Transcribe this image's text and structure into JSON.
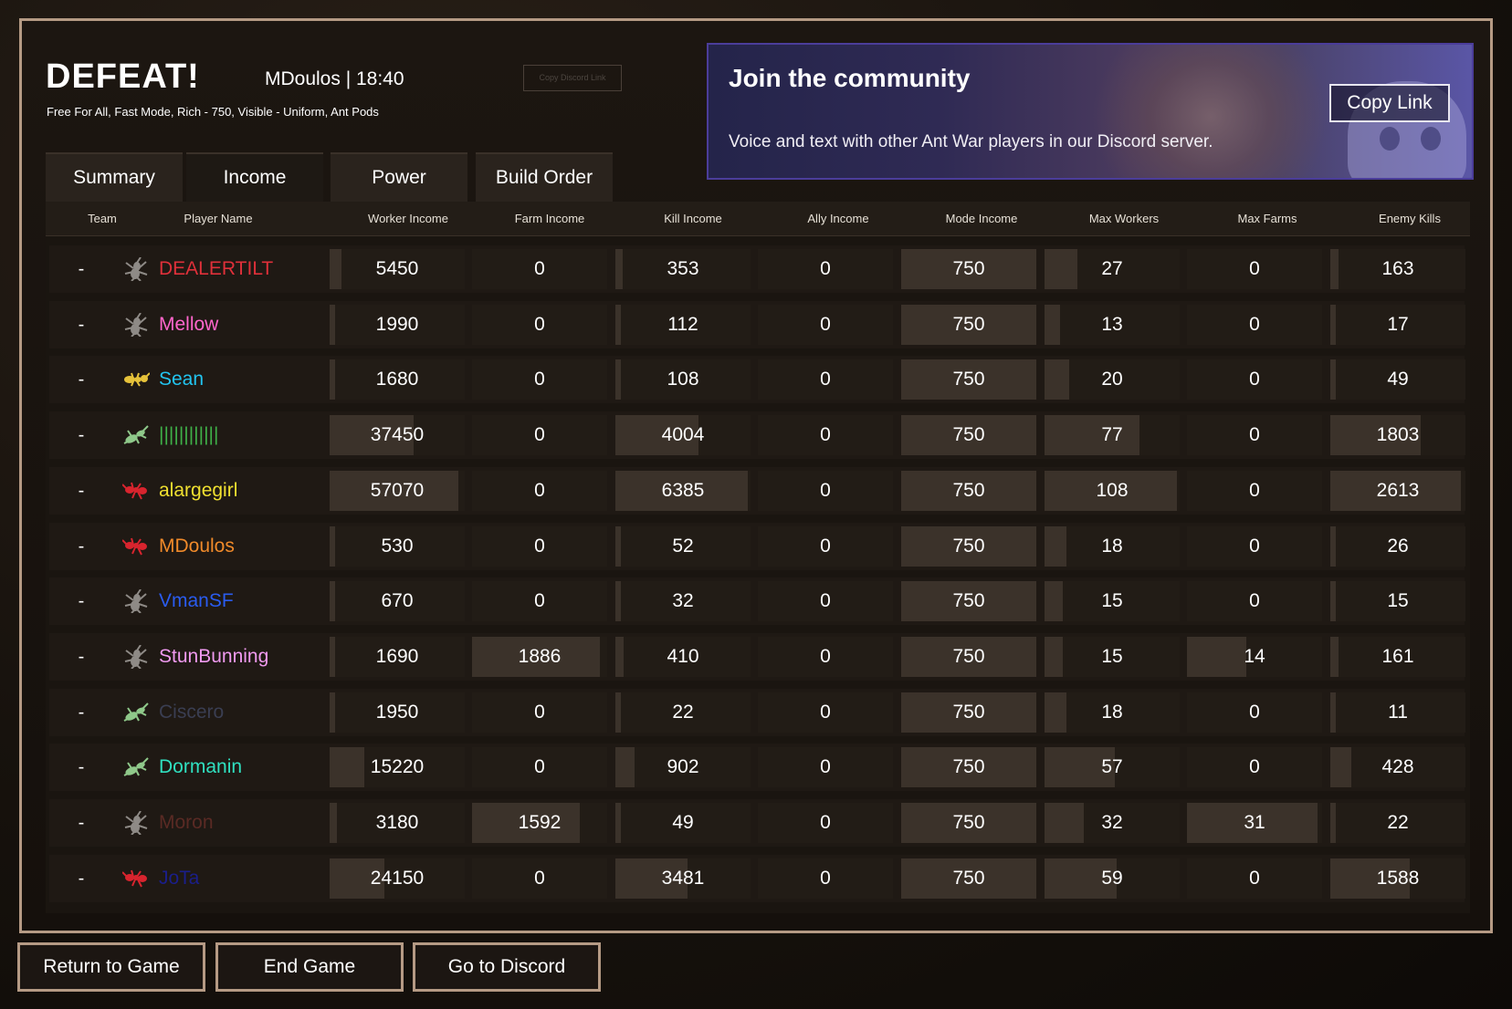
{
  "header": {
    "title": "DEFEAT!",
    "player_time": "MDoulos | 18:40",
    "subtitle": "Free For All, Fast Mode, Rich - 750, Visible - Uniform, Ant Pods",
    "copy_discord_small": "Copy Discord Link"
  },
  "banner": {
    "title": "Join the community",
    "text": "Voice and text with other Ant War players in our Discord server.",
    "copy_link": "Copy Link"
  },
  "tabs": [
    {
      "label": "Summary"
    },
    {
      "label": "Income"
    },
    {
      "label": "Power"
    },
    {
      "label": "Build Order"
    }
  ],
  "active_tab": "Income",
  "columns": [
    "Team",
    "Player Name",
    "Worker Income",
    "Farm Income",
    "Kill Income",
    "Ally Income",
    "Mode Income",
    "Max Workers",
    "Max Farms",
    "Enemy Kills"
  ],
  "rows": [
    {
      "team": "-",
      "name": "DEALERTILT",
      "color": "#e0303a",
      "unit": "gray-ant",
      "values": [
        5450,
        0,
        353,
        0,
        750,
        27,
        0,
        163
      ]
    },
    {
      "team": "-",
      "name": "Mellow",
      "color": "#ff66cc",
      "unit": "gray-ant",
      "values": [
        1990,
        0,
        112,
        0,
        750,
        13,
        0,
        17
      ]
    },
    {
      "team": "-",
      "name": "Sean",
      "color": "#22c4f0",
      "unit": "yellow-ant",
      "values": [
        1680,
        0,
        108,
        0,
        750,
        20,
        0,
        49
      ]
    },
    {
      "team": "-",
      "name": "||||||||||||",
      "color": "#3fb048",
      "unit": "green-ant",
      "values": [
        37450,
        0,
        4004,
        0,
        750,
        77,
        0,
        1803
      ]
    },
    {
      "team": "-",
      "name": "alargegirl",
      "color": "#f0e030",
      "unit": "red-ant",
      "values": [
        57070,
        0,
        6385,
        0,
        750,
        108,
        0,
        2613
      ]
    },
    {
      "team": "-",
      "name": "MDoulos",
      "color": "#f08a2a",
      "unit": "red-ant",
      "values": [
        530,
        0,
        52,
        0,
        750,
        18,
        0,
        26
      ]
    },
    {
      "team": "-",
      "name": "VmanSF",
      "color": "#2a5cf0",
      "unit": "gray-ant",
      "values": [
        670,
        0,
        32,
        0,
        750,
        15,
        0,
        15
      ]
    },
    {
      "team": "-",
      "name": "StunBunning",
      "color": "#f09af0",
      "unit": "gray-ant",
      "values": [
        1690,
        1886,
        410,
        0,
        750,
        15,
        14,
        161
      ]
    },
    {
      "team": "-",
      "name": "Ciscero",
      "color": "#3a3e52",
      "unit": "green-ant",
      "values": [
        1950,
        0,
        22,
        0,
        750,
        18,
        0,
        11
      ]
    },
    {
      "team": "-",
      "name": "Dormanin",
      "color": "#30e0c0",
      "unit": "green-ant",
      "values": [
        15220,
        0,
        902,
        0,
        750,
        57,
        0,
        428
      ]
    },
    {
      "team": "-",
      "name": "Moron",
      "color": "#5a2a24",
      "unit": "gray-ant",
      "values": [
        3180,
        1592,
        49,
        0,
        750,
        32,
        31,
        22
      ]
    },
    {
      "team": "-",
      "name": "JoTa",
      "color": "#1a1e8a",
      "unit": "red-ant",
      "values": [
        24150,
        0,
        3481,
        0,
        750,
        59,
        0,
        1588
      ]
    }
  ],
  "buttons": {
    "return": "Return to Game",
    "end": "End Game",
    "discord": "Go to Discord"
  }
}
